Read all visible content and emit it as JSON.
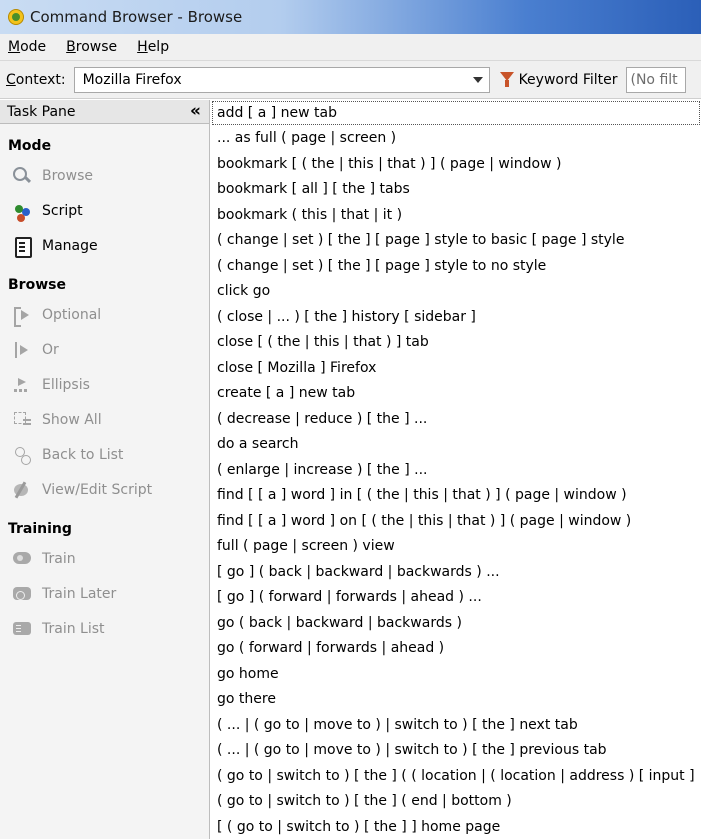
{
  "window": {
    "title": "Command Browser - Browse"
  },
  "menu": {
    "items": [
      {
        "underline": "M",
        "rest": "ode"
      },
      {
        "underline": "B",
        "rest": "rowse"
      },
      {
        "underline": "H",
        "rest": "elp"
      }
    ]
  },
  "context": {
    "label_underline": "C",
    "label_rest": "ontext:",
    "value": "Mozilla Firefox",
    "keyword_filter_label": "Keyword Filter",
    "keyword_filter_value": "(No filt"
  },
  "task_pane": {
    "title": "Task Pane",
    "collapse_glyph": "«",
    "sections": [
      {
        "title": "Mode",
        "items": [
          {
            "label": "Browse",
            "icon": "browse-icon",
            "enabled": false
          },
          {
            "label": "Script",
            "icon": "script-icon",
            "enabled": true
          },
          {
            "label": "Manage",
            "icon": "manage-icon",
            "enabled": true
          }
        ]
      },
      {
        "title": "Browse",
        "items": [
          {
            "label": "Optional",
            "icon": "optional-icon",
            "enabled": false
          },
          {
            "label": "Or",
            "icon": "or-icon",
            "enabled": false
          },
          {
            "label": "Ellipsis",
            "icon": "ellipsis-icon",
            "enabled": false
          },
          {
            "label": "Show All",
            "icon": "show-all-icon",
            "enabled": false
          },
          {
            "label": "Back to List",
            "icon": "back-to-list-icon",
            "enabled": false
          },
          {
            "label": "View/Edit Script",
            "icon": "view-edit-script-icon",
            "enabled": false
          }
        ]
      },
      {
        "title": "Training",
        "items": [
          {
            "label": "Train",
            "icon": "train-icon",
            "enabled": false
          },
          {
            "label": "Train Later",
            "icon": "train-later-icon",
            "enabled": false
          },
          {
            "label": "Train List",
            "icon": "train-list-icon",
            "enabled": false
          }
        ]
      }
    ]
  },
  "commands": [
    "add [ a ] new tab",
    "... as full ( page | screen )",
    "bookmark [ ( the | this | that ) ] ( page | window )",
    "bookmark [ all ] [ the ] tabs",
    "bookmark ( this | that | it )",
    "( change | set ) [ the ] [ page ] style to basic [ page ] style",
    "( change | set ) [ the ] [ page ] style to no style",
    "click go",
    "( close | ... ) [ the ] history [ sidebar ]",
    "close [ ( the | this | that ) ] tab",
    "close [ Mozilla ] Firefox",
    "create [ a ] new tab",
    "( decrease | reduce ) [ the ] ...",
    "do a search",
    "( enlarge | increase ) [ the ] ...",
    "find [ [ a ] word ] in [ ( the | this | that ) ] ( page | window )",
    "find [ [ a ] word ] on [ ( the | this | that ) ] ( page | window )",
    "full ( page | screen ) view",
    "[ go ] ( back | backward | backwards ) ...",
    "[ go ] ( forward | forwards | ahead ) ...",
    "go ( back | backward | backwards )",
    "go ( forward | forwards | ahead )",
    "go home",
    "go there",
    "( ... | ( go to | move to ) | switch to ) [ the ] next tab",
    "( ... | ( go to | move to ) | switch to ) [ the ] previous tab",
    "( go to | switch to ) [ the ] ( ( location | ( location | address ) [ input ]",
    "( go to | switch to ) [ the ] ( end | bottom )",
    "[ ( go to | switch to ) [ the ] ] home page"
  ]
}
